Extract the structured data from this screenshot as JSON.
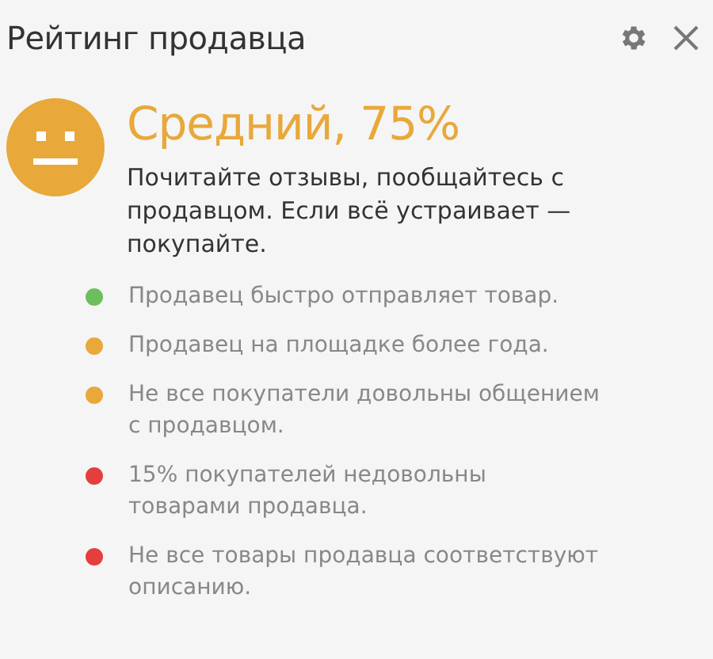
{
  "header": {
    "title": "Рейтинг продавца"
  },
  "rating": {
    "headline": "Средний, 75%",
    "color": "#e8a83a",
    "summary": "Почитайте отзывы, пообщайтесь с продавцом. Если всё устраивает — покупайте."
  },
  "factors": [
    {
      "text": "Продавец быстро отправляет товар.",
      "color": "#6cbf5c"
    },
    {
      "text": "Продавец на площадке более года.",
      "color": "#e8a83a"
    },
    {
      "text": "Не все покупатели довольны общением с продавцом.",
      "color": "#e8a83a"
    },
    {
      "text": "15% покупателей недовольны товарами продавца.",
      "color": "#e53e3e"
    },
    {
      "text": "Не все товары продавца соответствуют описанию.",
      "color": "#e53e3e"
    }
  ]
}
